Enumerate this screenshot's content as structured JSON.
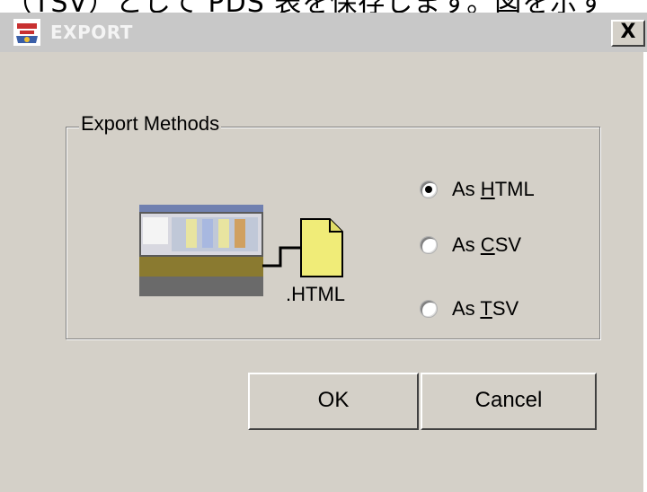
{
  "background_text": "（TSV）として PDS 表を保存します。図を示す",
  "window": {
    "title": "EXPORT",
    "close_label": "X",
    "icon": "app-logo-icon"
  },
  "group": {
    "legend": "Export Methods",
    "preview_caption": ".HTML"
  },
  "options": [
    {
      "prefix": "As ",
      "mnemonic": "H",
      "suffix": "TML",
      "selected": true
    },
    {
      "prefix": "As ",
      "mnemonic": "C",
      "suffix": "SV",
      "selected": false
    },
    {
      "prefix": "As ",
      "mnemonic": "T",
      "suffix": "SV",
      "selected": false
    }
  ],
  "buttons": {
    "ok": "OK",
    "cancel": "Cancel"
  },
  "colors": {
    "dialog_bg": "#d4d0c8",
    "titlebar_bg": "#c8c8c8",
    "file_icon": "#f0ec78"
  }
}
